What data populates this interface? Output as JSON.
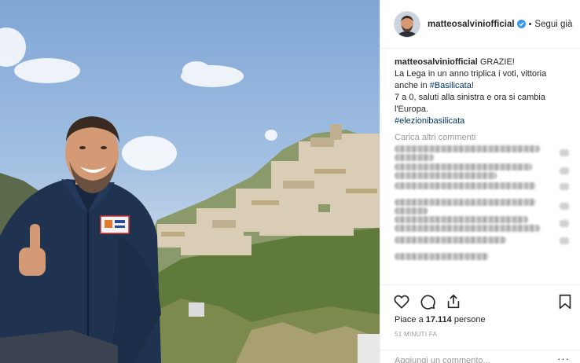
{
  "post": {
    "username": "matteosalviniofficial",
    "follow_separator": "•",
    "follow_label": "Segui già",
    "caption_username": "matteosalviniofficial",
    "caption_lines": [
      "GRAZIE!",
      "La Lega in un anno triplica i voti, vittoria",
      "anche in #Basilicata!",
      "7 a 0, saluti alla sinistra e ora si cambia",
      "l'Europa."
    ],
    "caption_line3_prefix": "anche in ",
    "caption_line3_hashtag": "#Basilicata",
    "caption_line3_suffix": "!",
    "hashtag_line": "#elezionibasilicata",
    "load_more": "Carica altri commenti",
    "likes_prefix": "Piace a ",
    "likes_count": "17.114",
    "likes_suffix": " persone",
    "time": "51 MINUTI FA",
    "add_comment_placeholder": "Aggiungi un commento...",
    "more_label": "···"
  },
  "icons": {
    "like": "heart-icon",
    "comment": "comment-bubble-icon",
    "share": "share-icon",
    "save": "bookmark-icon",
    "verified": "verified-badge-icon"
  },
  "colors": {
    "hashtag": "#003569",
    "verified": "#3897f0",
    "muted": "#999999",
    "text": "#262626"
  }
}
